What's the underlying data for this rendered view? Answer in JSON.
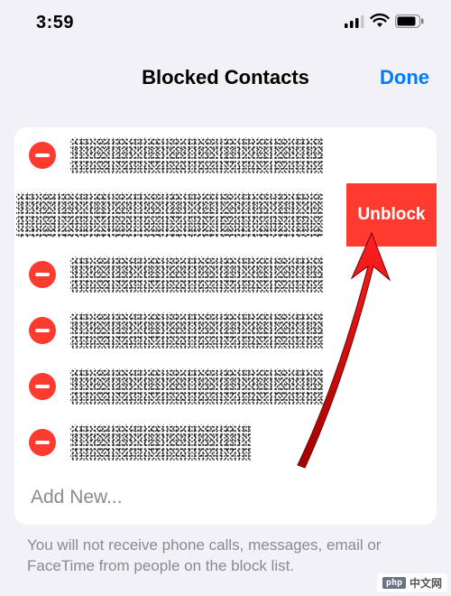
{
  "statusbar": {
    "time": "3:59"
  },
  "header": {
    "title": "Blocked Contacts",
    "done": "Done"
  },
  "rows": {
    "unblock_label": "Unblock",
    "add_new": "Add New..."
  },
  "footer": "You will not receive phone calls, messages, email or FaceTime from people on the block list.",
  "watermark": {
    "badge": "php",
    "text": "中文网"
  }
}
